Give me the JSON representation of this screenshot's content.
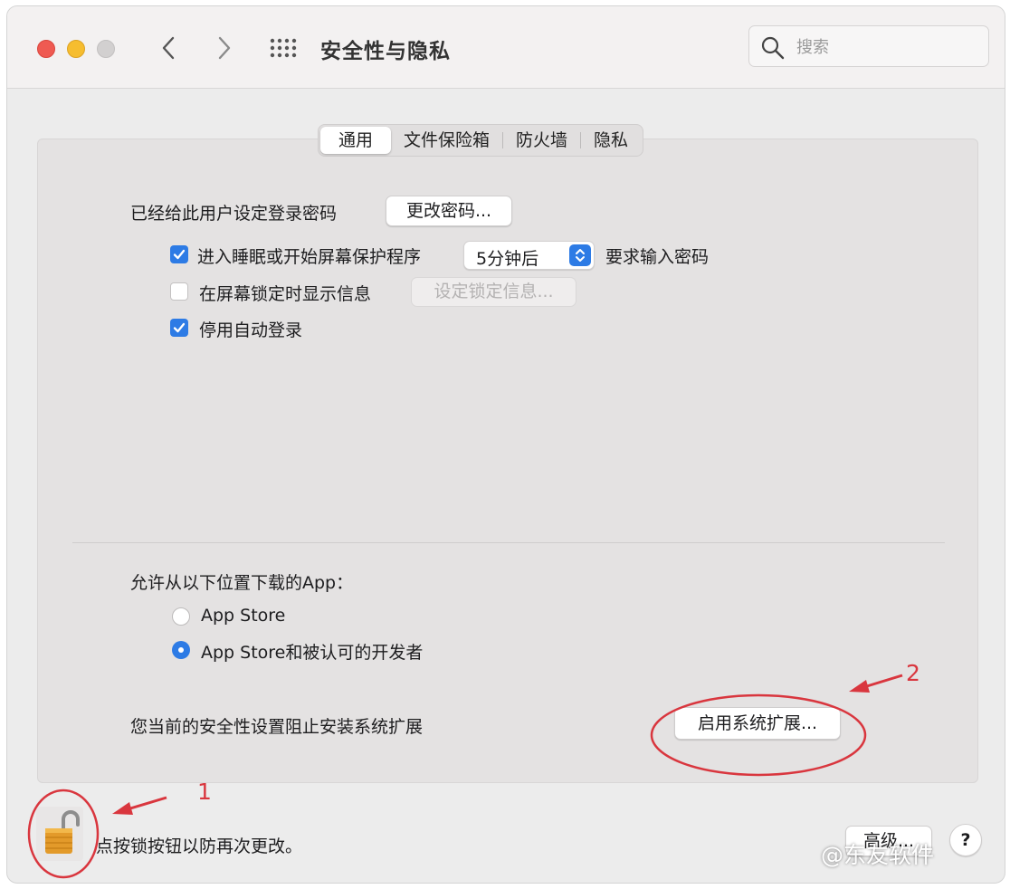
{
  "window": {
    "title": "安全性与隐私",
    "search_placeholder": "搜索"
  },
  "tabs": [
    {
      "label": "通用",
      "active": true
    },
    {
      "label": "文件保险箱",
      "active": false
    },
    {
      "label": "防火墙",
      "active": false
    },
    {
      "label": "隐私",
      "active": false
    }
  ],
  "general": {
    "password_label": "已经给此用户设定登录密码",
    "change_password_button": "更改密码...",
    "require_password": {
      "checked": true,
      "label": "进入睡眠或开始屏幕保护程序",
      "delay_value": "5分钟后",
      "suffix": "要求输入密码"
    },
    "lock_message": {
      "checked": false,
      "label": "在屏幕锁定时显示信息",
      "button": "设定锁定信息..."
    },
    "disable_auto_login": {
      "checked": true,
      "label": "停用自动登录"
    }
  },
  "downloads": {
    "heading": "允许从以下位置下载的App：",
    "options": [
      {
        "label": "App Store",
        "selected": false
      },
      {
        "label": "App Store和被认可的开发者",
        "selected": true
      }
    ]
  },
  "extensions": {
    "message": "您当前的安全性设置阻止安装系统扩展",
    "button": "启用系统扩展..."
  },
  "footer": {
    "lock_text": "点按锁按钮以防再次更改。",
    "advanced_button": "高级...",
    "help_button": "?"
  },
  "annotations": {
    "marker_1": "1",
    "marker_2": "2",
    "color": "#d9363e"
  },
  "watermark": "@东友软件",
  "colors": {
    "accent": "#2d7be5",
    "close": "#ef5a52",
    "minimize": "#f6bd2f",
    "disabled": "#d2d0d0",
    "lock": "#e39a2a"
  }
}
